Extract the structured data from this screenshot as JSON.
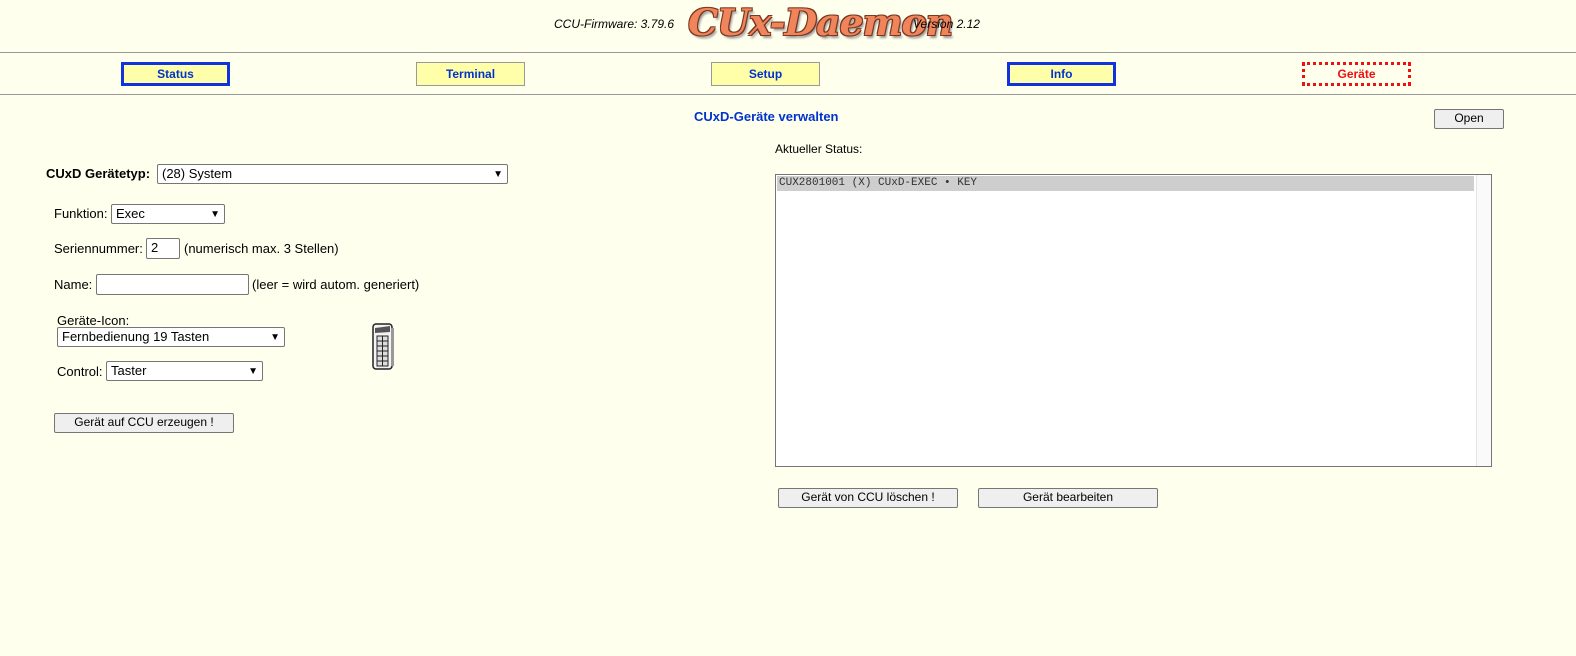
{
  "header": {
    "firmware": "CCU-Firmware: 3.79.6",
    "logo": "CUx-Daemon",
    "version": "Version 2.12"
  },
  "nav": {
    "status": "Status",
    "terminal": "Terminal",
    "setup": "Setup",
    "info": "Info",
    "geraete": "Geräte"
  },
  "page": {
    "title": "CUxD-Geräte verwalten",
    "open_button": "Open"
  },
  "form": {
    "device_type_label": "CUxD Gerätetyp:",
    "device_type_value": "(28) System",
    "function_label": "Funktion:",
    "function_value": "Exec",
    "serial_label": "Seriennummer:",
    "serial_value": "2",
    "serial_hint": "(numerisch max. 3 Stellen)",
    "name_label": "Name:",
    "name_value": "",
    "name_hint": "(leer = wird autom. generiert)",
    "icon_label": "Geräte-Icon:",
    "icon_value": "Fernbedienung 19 Tasten",
    "icon_name": "remote-control-19-keys-icon",
    "control_label": "Control:",
    "control_value": "Taster",
    "create_button": "Gerät auf CCU erzeugen !"
  },
  "status": {
    "label": "Aktueller Status:",
    "rows": [
      "CUX2801001 (X) CUxD-EXEC • KEY"
    ],
    "delete_button": "Gerät von CCU löschen !",
    "edit_button": "Gerät bearbeiten"
  }
}
